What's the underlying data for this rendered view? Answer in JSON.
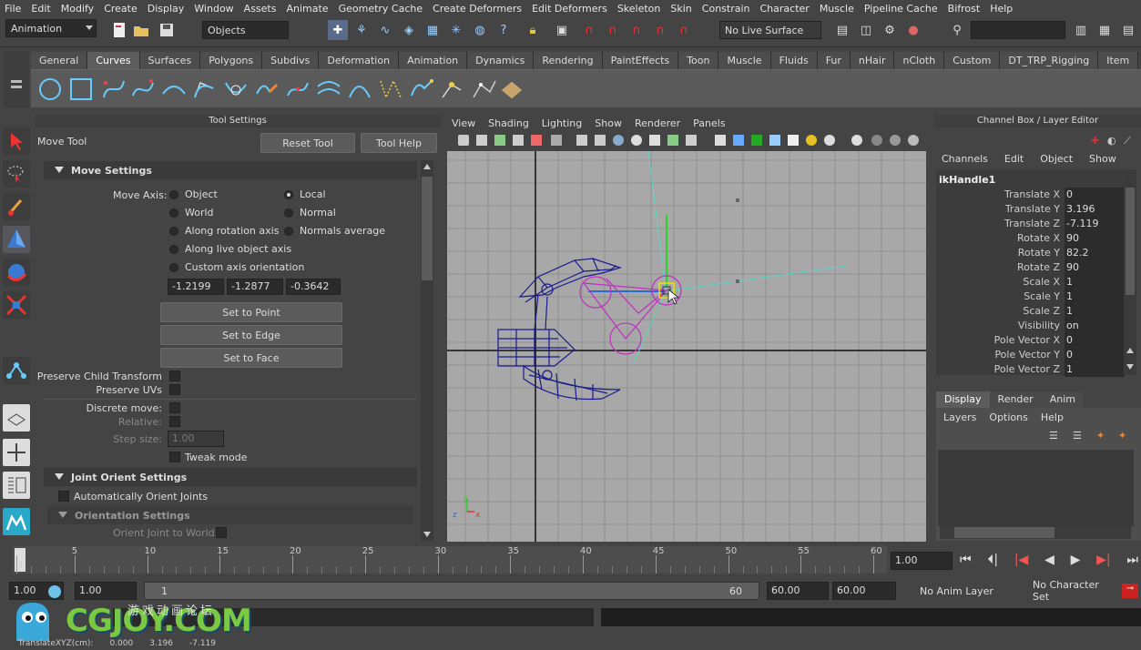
{
  "menubar": [
    "File",
    "Edit",
    "Modify",
    "Create",
    "Display",
    "Window",
    "Assets",
    "Animate",
    "Geometry Cache",
    "Create Deformers",
    "Edit Deformers",
    "Skeleton",
    "Skin",
    "Constrain",
    "Character",
    "Muscle",
    "Pipeline Cache",
    "Bifrost",
    "Help"
  ],
  "status": {
    "menu_set": "Animation",
    "selection_mode": "Objects",
    "live_surface": "No Live Surface"
  },
  "shelf_tabs": [
    "General",
    "Curves",
    "Surfaces",
    "Polygons",
    "Subdivs",
    "Deformation",
    "Animation",
    "Dynamics",
    "Rendering",
    "PaintEffects",
    "Toon",
    "Muscle",
    "Fluids",
    "Fur",
    "nHair",
    "nCloth",
    "Custom",
    "DT_TRP_Rigging",
    "Item"
  ],
  "shelf_active": "Curves",
  "tool_settings": {
    "panel_title": "Tool Settings",
    "tool_name": "Move Tool",
    "reset_button": "Reset Tool",
    "help_button": "Tool Help",
    "move_settings_title": "Move Settings",
    "move_axis_label": "Move Axis:",
    "axis_options": {
      "object": "Object",
      "local": "Local",
      "world": "World",
      "normal": "Normal",
      "along_rotation": "Along rotation axis",
      "normals_average": "Normals average",
      "along_live": "Along live object axis",
      "custom": "Custom axis orientation"
    },
    "axis_selected": "Local",
    "custom_values": [
      "-1.2199",
      "-1.2877",
      "-0.3642"
    ],
    "set_to_point": "Set to Point",
    "set_to_edge": "Set to Edge",
    "set_to_face": "Set to Face",
    "preserve_child": "Preserve Child Transform",
    "preserve_uvs": "Preserve UVs",
    "discrete_move": "Discrete move:",
    "relative": "Relative:",
    "step_size_label": "Step size:",
    "step_size_value": "1.00",
    "tweak_mode": "Tweak mode",
    "joint_orient_title": "Joint Orient Settings",
    "auto_orient": "Automatically Orient Joints",
    "orientation_title": "Orientation Settings",
    "orient_world": "Orient Joint to World:"
  },
  "viewport": {
    "menu": [
      "View",
      "Shading",
      "Lighting",
      "Show",
      "Renderer",
      "Panels"
    ],
    "axis_labels": {
      "y": "y",
      "z": "z",
      "x": "x"
    }
  },
  "channel_box": {
    "title": "Channel Box / Layer Editor",
    "menu": [
      "Channels",
      "Edit",
      "Object",
      "Show"
    ],
    "node": "ikHandle1",
    "channels": [
      {
        "name": "Translate X",
        "value": "0"
      },
      {
        "name": "Translate Y",
        "value": "3.196"
      },
      {
        "name": "Translate Z",
        "value": "-7.119"
      },
      {
        "name": "Rotate X",
        "value": "90"
      },
      {
        "name": "Rotate Y",
        "value": "82.2"
      },
      {
        "name": "Rotate Z",
        "value": "90"
      },
      {
        "name": "Scale X",
        "value": "1"
      },
      {
        "name": "Scale Y",
        "value": "1"
      },
      {
        "name": "Scale Z",
        "value": "1"
      },
      {
        "name": "Visibility",
        "value": "on"
      },
      {
        "name": "Pole Vector X",
        "value": "0"
      },
      {
        "name": "Pole Vector Y",
        "value": "0"
      },
      {
        "name": "Pole Vector Z",
        "value": "1"
      }
    ],
    "layer_tabs": [
      "Display",
      "Render",
      "Anim"
    ],
    "layer_active": "Display",
    "layer_menu": [
      "Layers",
      "Options",
      "Help"
    ]
  },
  "timeline": {
    "ticks": [
      "1",
      "5",
      "10",
      "15",
      "20",
      "25",
      "30",
      "35",
      "40",
      "45",
      "50",
      "55",
      "60"
    ],
    "current_frame": "1.00",
    "range_start_outer": "1.00",
    "range_start": "1.00",
    "range_slider_start": "1",
    "range_slider_end": "60",
    "range_end": "60.00",
    "range_end_outer": "60.00",
    "anim_layer": "No Anim Layer",
    "character_set": "No Character Set"
  },
  "watermark": {
    "site": "CGJOY.COM",
    "tagline": "游戏动画论坛"
  },
  "help_line": {
    "label": "TranslateXYZ(cm):",
    "x": "0.000",
    "y": "3.196",
    "z": "-7.119"
  },
  "colors": {
    "bg": "#444444",
    "viewport": "#a8a8a8",
    "joint_blue": "#1b1b8f",
    "ik_magenta": "#c030c0",
    "handle_yellow": "#f0e000",
    "axis_green": "#2ad32a"
  }
}
